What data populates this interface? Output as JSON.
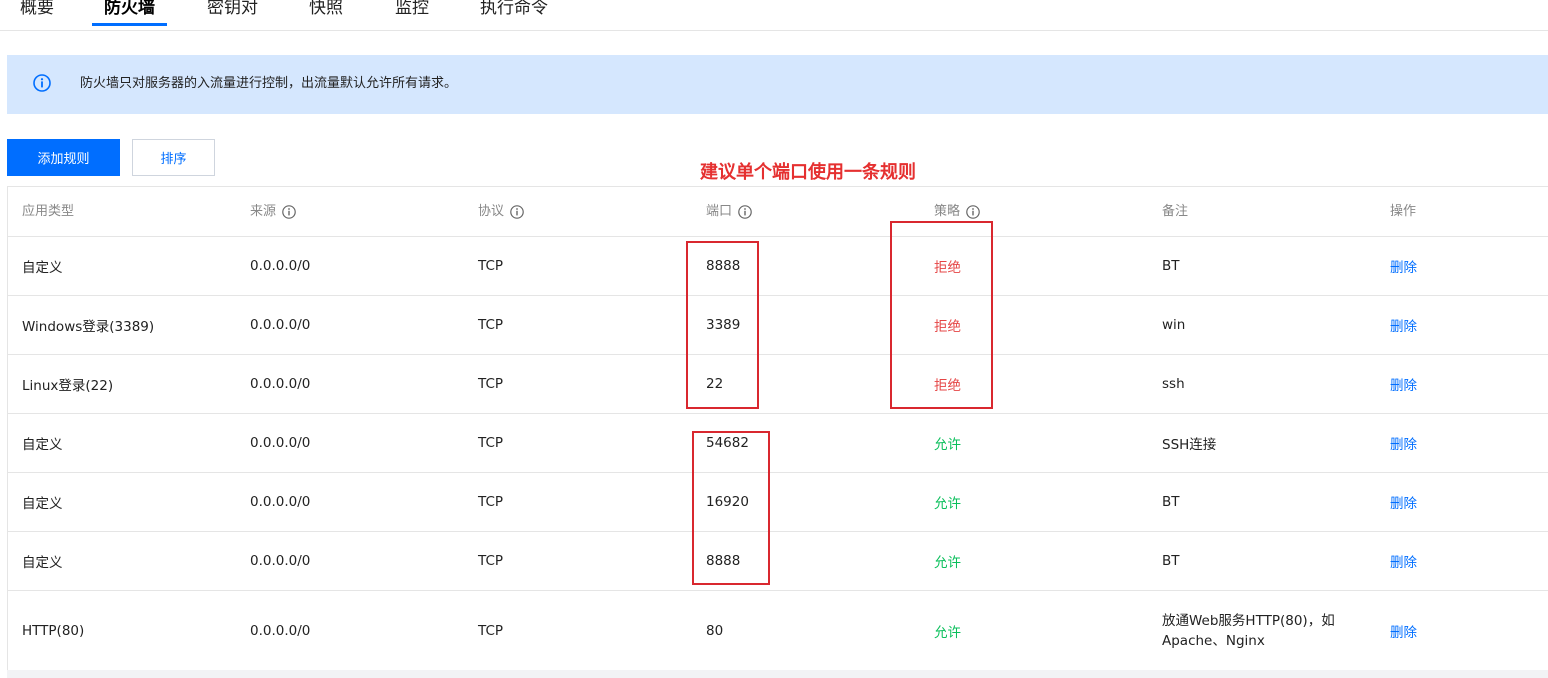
{
  "tabs": [
    {
      "label": "概要"
    },
    {
      "label": "防火墙"
    },
    {
      "label": "密钥对"
    },
    {
      "label": "快照"
    },
    {
      "label": "监控"
    },
    {
      "label": "执行命令"
    }
  ],
  "notice": {
    "text": "防火墙只对服务器的入流量进行控制，出流量默认允许所有请求。",
    "icon": "info-circle-icon"
  },
  "toolbar": {
    "add_rule_label": "添加规则",
    "sort_label": "排序"
  },
  "annotation": "建议单个端口使用一条规则",
  "table": {
    "headers": {
      "app_type": "应用类型",
      "source": "来源",
      "protocol": "协议",
      "port": "端口",
      "policy": "策略",
      "remark": "备注",
      "action": "操作"
    },
    "rows": [
      {
        "app_type": "自定义",
        "source": "0.0.0.0/0",
        "protocol": "TCP",
        "port": "8888",
        "policy": "拒绝",
        "remark": "BT",
        "action": "删除"
      },
      {
        "app_type": "Windows登录(3389)",
        "source": "0.0.0.0/0",
        "protocol": "TCP",
        "port": "3389",
        "policy": "拒绝",
        "remark": "win",
        "action": "删除"
      },
      {
        "app_type": "Linux登录(22)",
        "source": "0.0.0.0/0",
        "protocol": "TCP",
        "port": "22",
        "policy": "拒绝",
        "remark": "ssh",
        "action": "删除"
      },
      {
        "app_type": "自定义",
        "source": "0.0.0.0/0",
        "protocol": "TCP",
        "port": "54682",
        "policy": "允许",
        "remark": "SSH连接",
        "action": "删除"
      },
      {
        "app_type": "自定义",
        "source": "0.0.0.0/0",
        "protocol": "TCP",
        "port": "16920",
        "policy": "允许",
        "remark": "BT",
        "action": "删除"
      },
      {
        "app_type": "自定义",
        "source": "0.0.0.0/0",
        "protocol": "TCP",
        "port": "8888",
        "policy": "允许",
        "remark": "BT",
        "action": "删除"
      },
      {
        "app_type": "HTTP(80)",
        "source": "0.0.0.0/0",
        "protocol": "TCP",
        "port": "80",
        "policy": "允许",
        "remark": "放通Web服务HTTP(80)，如Apache、Nginx",
        "action": "删除"
      }
    ]
  },
  "colors": {
    "primary": "#006eff",
    "deny": "#e54545",
    "allow": "#0abf5b",
    "annotation": "#e53030"
  }
}
